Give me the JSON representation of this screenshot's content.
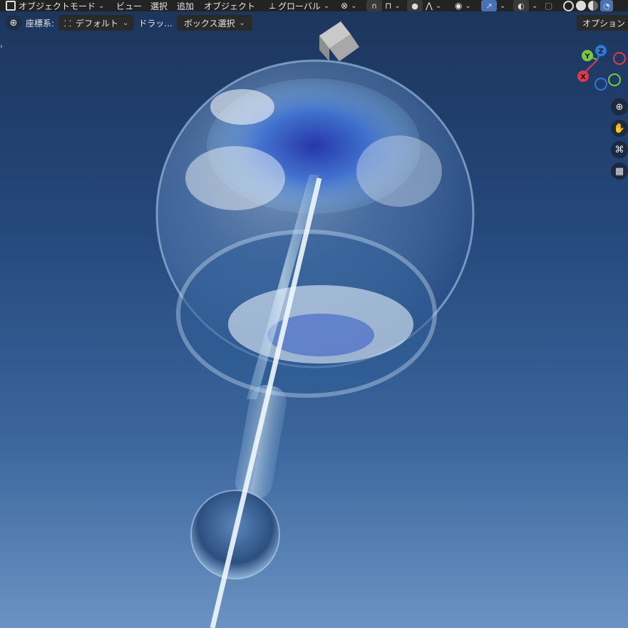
{
  "header": {
    "mode": "オブジェクトモード",
    "menus": [
      "ビュー",
      "選択",
      "追加",
      "オブジェクト"
    ],
    "orientation": "グローバル"
  },
  "toolsettings": {
    "coord_label": "座標系:",
    "coord_value": "デフォルト",
    "drag_label": "ドラッ...",
    "drag_value": "ボックス選択",
    "options": "オプション"
  },
  "gizmo": {
    "y": "Y",
    "z": "Z",
    "x": "X"
  },
  "colors": {
    "header_bg": "#232323",
    "active_blue": "#4772b3",
    "axis_x": "#e0394d",
    "axis_y": "#7ac93a",
    "axis_z": "#2f7ad8"
  },
  "icons": [
    "object-mode-icon",
    "transform-orientation-icon",
    "pivot-icon",
    "snap-icon",
    "proportional-edit-icon",
    "visibility-icon",
    "gizmo-icon",
    "overlay-icon",
    "xray-icon",
    "shading-wire-icon",
    "shading-solid-icon",
    "shading-material-icon",
    "shading-rendered-icon",
    "zoom-icon",
    "pan-hand-icon",
    "camera-icon",
    "ortho-grid-icon"
  ]
}
